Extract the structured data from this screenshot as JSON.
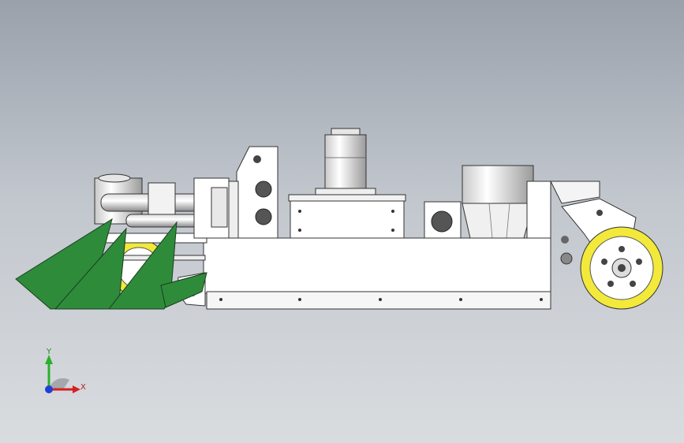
{
  "viewport": {
    "background_top": "#9aa1ab",
    "background_bottom": "#d9dcdf"
  },
  "model": {
    "body_fill": "#ffffff",
    "edge_color": "#333333",
    "blade_color": "#2e8b3a",
    "tire_color": "#f2e93a"
  },
  "triad": {
    "y_label": "Y",
    "x_label": "X",
    "y_color": "#2bb02b",
    "x_color": "#d62020",
    "z_color": "#1f3fd6"
  }
}
